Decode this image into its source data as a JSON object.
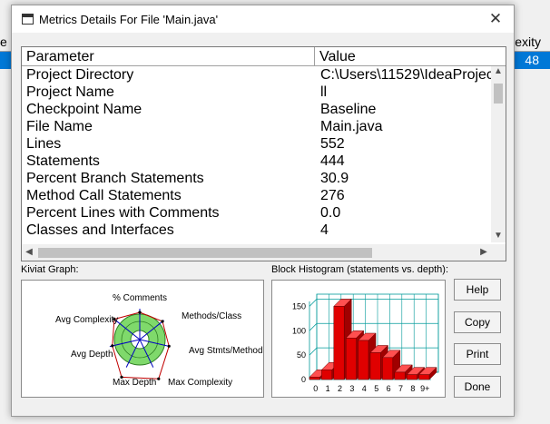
{
  "background": {
    "header_left": "e",
    "header_right": "exity",
    "row_value": "48"
  },
  "dialog": {
    "title": "Metrics Details For File 'Main.java'",
    "close_symbol": "✕"
  },
  "table": {
    "headers": [
      "Parameter",
      "Value"
    ],
    "rows": [
      {
        "param": "Project Directory",
        "value": "C:\\Users\\11529\\IdeaProjec"
      },
      {
        "param": "Project Name",
        "value": "ll"
      },
      {
        "param": "Checkpoint Name",
        "value": "Baseline"
      },
      {
        "param": "File Name",
        "value": "Main.java"
      },
      {
        "param": "Lines",
        "value": "552"
      },
      {
        "param": "Statements",
        "value": "444"
      },
      {
        "param": "Percent Branch Statements",
        "value": "30.9"
      },
      {
        "param": "Method Call Statements",
        "value": "276"
      },
      {
        "param": "Percent Lines with Comments",
        "value": "0.0"
      },
      {
        "param": "Classes and Interfaces",
        "value": "4"
      }
    ]
  },
  "kiviat": {
    "label": "Kiviat Graph:",
    "axes": [
      "% Comments",
      "Methods/Class",
      "Avg Stmts/Method",
      "Max Complexity",
      "Max Depth",
      "Avg Depth",
      "Avg Complexity"
    ],
    "colors": {
      "normal_band": "#7fd96b",
      "inner": "#ffffff",
      "polygon": "#c00000",
      "axis": "#0000c0"
    }
  },
  "histogram": {
    "label": "Block Histogram (statements vs. depth):",
    "colors": {
      "bar": "#e00000",
      "grid": "#009a9a"
    }
  },
  "chart_data": {
    "type": "bar",
    "title": "Block Histogram (statements vs. depth):",
    "categories": [
      "0",
      "1",
      "2",
      "3",
      "4",
      "5",
      "6",
      "7",
      "8",
      "9+"
    ],
    "values": [
      5,
      20,
      150,
      85,
      80,
      55,
      45,
      15,
      10,
      10
    ],
    "ylim": [
      0,
      160
    ],
    "yticks": [
      "0",
      "50",
      "100",
      "150"
    ],
    "xlabels": [
      "0",
      "1",
      "2",
      "3",
      "4",
      "5",
      "6",
      "7",
      "8",
      "9+"
    ]
  },
  "buttons": {
    "help": "Help",
    "copy": "Copy",
    "print": "Print",
    "done": "Done"
  }
}
